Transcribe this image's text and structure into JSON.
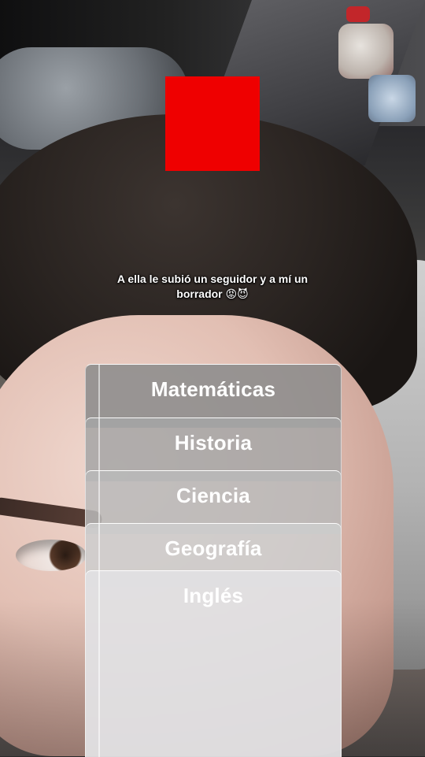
{
  "overlay": {
    "caption": "A ella le subió un seguidor y a mí un borrador 😡😈",
    "square_color": "#ef0000"
  },
  "subjects": [
    {
      "label": "Matemáticas"
    },
    {
      "label": "Historia"
    },
    {
      "label": "Ciencia"
    },
    {
      "label": "Geografía"
    },
    {
      "label": "Inglés"
    }
  ]
}
